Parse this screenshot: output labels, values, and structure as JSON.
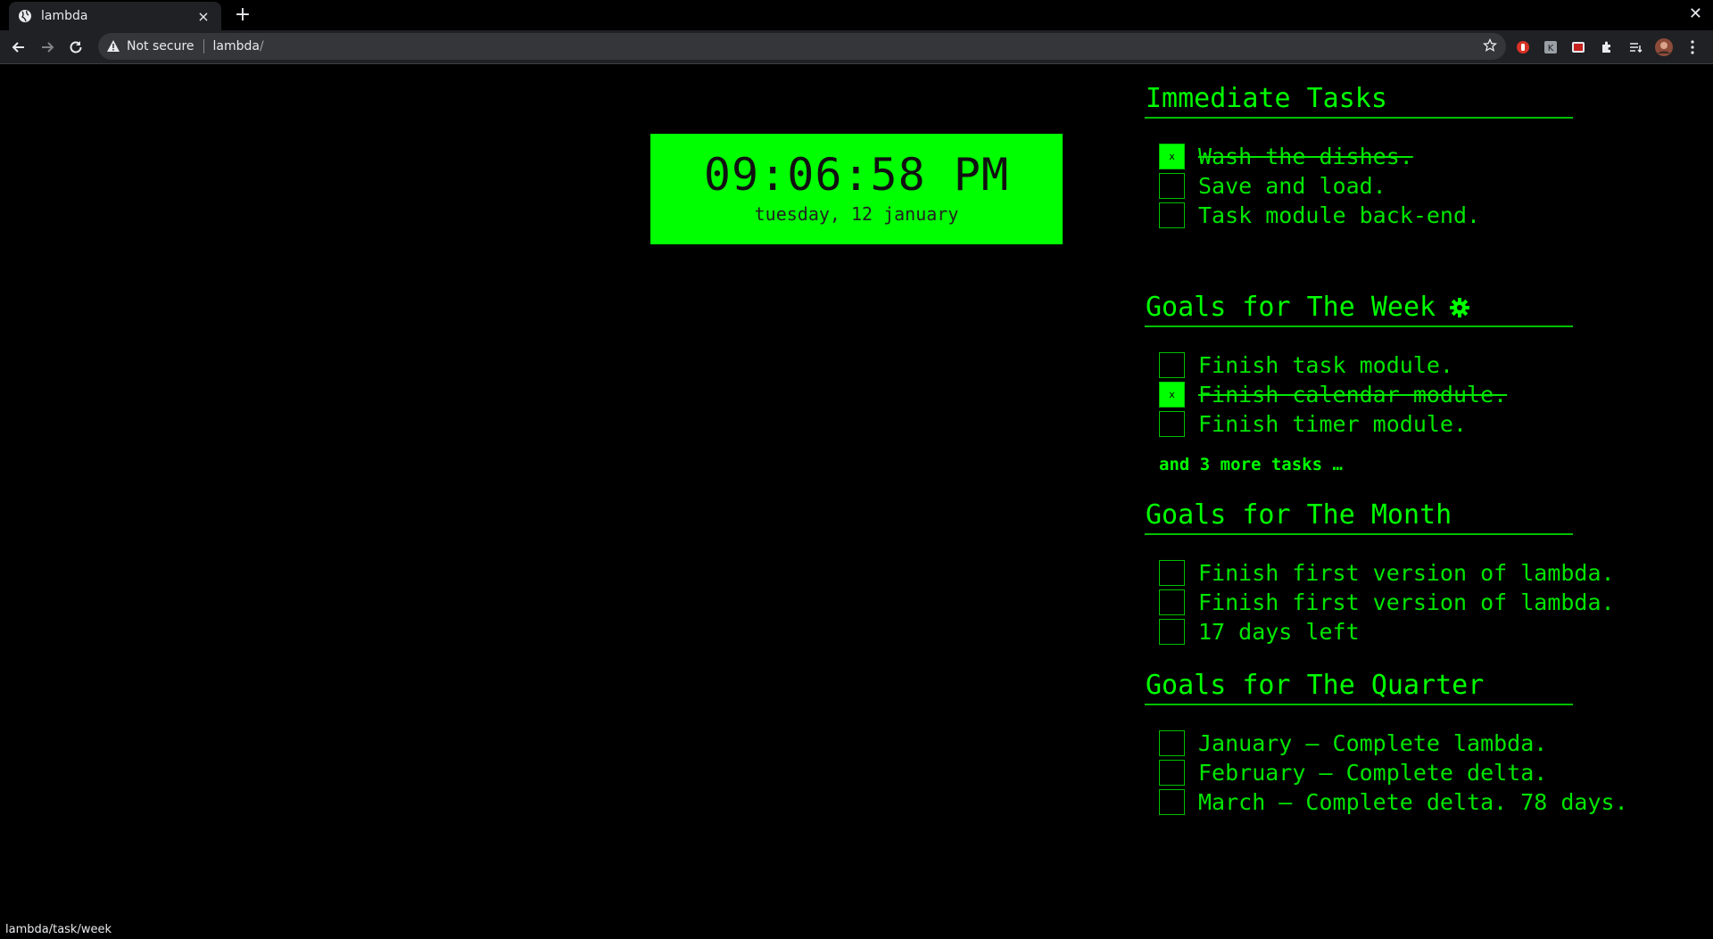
{
  "browser": {
    "tab_title": "lambda",
    "tab_close": "×",
    "new_tab": "+",
    "window_close": "✕",
    "security_label": "Not secure",
    "url_host": "lambda",
    "url_path": "/",
    "icons": [
      "globe-icon",
      "back-icon",
      "forward-icon",
      "reload-icon",
      "warning-icon",
      "star-icon",
      "extensions-icon",
      "reading-list-icon",
      "profile-icon"
    ]
  },
  "clock": {
    "time": "09:06:58 PM",
    "date": "tuesday, 12 january"
  },
  "sections": {
    "immediate": {
      "title": "Immediate Tasks",
      "tasks": [
        {
          "label": "Wash the dishes.",
          "done": true,
          "mark": "x"
        },
        {
          "label": "Save and load.",
          "done": false
        },
        {
          "label": "Task module back-end.",
          "done": false
        }
      ]
    },
    "week": {
      "title": "Goals for The Week",
      "tasks": [
        {
          "label": "Finish task module.",
          "done": false
        },
        {
          "label": "Finish calendar module.",
          "done": true,
          "mark": "x"
        },
        {
          "label": "Finish timer module.",
          "done": false
        }
      ],
      "more": "and 3 more tasks …"
    },
    "month": {
      "title": "Goals for The Month",
      "tasks": [
        {
          "label": "Finish first version of lambda.",
          "done": false
        },
        {
          "label": "Finish first version of lambda.",
          "done": false
        },
        {
          "label": "17 days left",
          "done": false
        }
      ]
    },
    "quarter": {
      "title": "Goals for The Quarter",
      "tasks": [
        {
          "label": "January – Complete lambda.",
          "done": false
        },
        {
          "label": "February – Complete delta.",
          "done": false
        },
        {
          "label": "March – Complete delta. 78 days.",
          "done": false
        }
      ]
    }
  },
  "status_url": "lambda/task/week",
  "colors": {
    "accent": "#00ff00",
    "text": "#00e600",
    "background": "#000000"
  }
}
